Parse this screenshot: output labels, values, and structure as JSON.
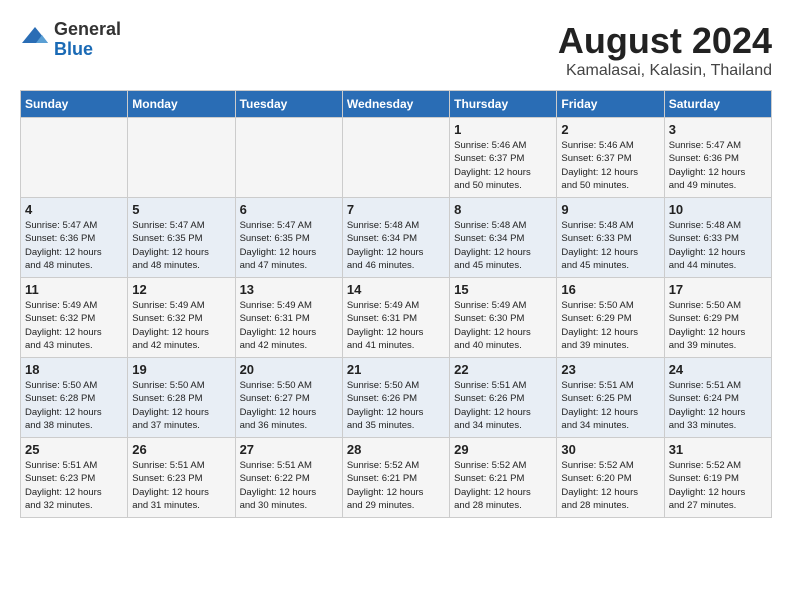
{
  "header": {
    "logo_general": "General",
    "logo_blue": "Blue",
    "month_year": "August 2024",
    "location": "Kamalasai, Kalasin, Thailand"
  },
  "days_of_week": [
    "Sunday",
    "Monday",
    "Tuesday",
    "Wednesday",
    "Thursday",
    "Friday",
    "Saturday"
  ],
  "weeks": [
    [
      {
        "day": "",
        "info": ""
      },
      {
        "day": "",
        "info": ""
      },
      {
        "day": "",
        "info": ""
      },
      {
        "day": "",
        "info": ""
      },
      {
        "day": "1",
        "info": "Sunrise: 5:46 AM\nSunset: 6:37 PM\nDaylight: 12 hours\nand 50 minutes."
      },
      {
        "day": "2",
        "info": "Sunrise: 5:46 AM\nSunset: 6:37 PM\nDaylight: 12 hours\nand 50 minutes."
      },
      {
        "day": "3",
        "info": "Sunrise: 5:47 AM\nSunset: 6:36 PM\nDaylight: 12 hours\nand 49 minutes."
      }
    ],
    [
      {
        "day": "4",
        "info": "Sunrise: 5:47 AM\nSunset: 6:36 PM\nDaylight: 12 hours\nand 48 minutes."
      },
      {
        "day": "5",
        "info": "Sunrise: 5:47 AM\nSunset: 6:35 PM\nDaylight: 12 hours\nand 48 minutes."
      },
      {
        "day": "6",
        "info": "Sunrise: 5:47 AM\nSunset: 6:35 PM\nDaylight: 12 hours\nand 47 minutes."
      },
      {
        "day": "7",
        "info": "Sunrise: 5:48 AM\nSunset: 6:34 PM\nDaylight: 12 hours\nand 46 minutes."
      },
      {
        "day": "8",
        "info": "Sunrise: 5:48 AM\nSunset: 6:34 PM\nDaylight: 12 hours\nand 45 minutes."
      },
      {
        "day": "9",
        "info": "Sunrise: 5:48 AM\nSunset: 6:33 PM\nDaylight: 12 hours\nand 45 minutes."
      },
      {
        "day": "10",
        "info": "Sunrise: 5:48 AM\nSunset: 6:33 PM\nDaylight: 12 hours\nand 44 minutes."
      }
    ],
    [
      {
        "day": "11",
        "info": "Sunrise: 5:49 AM\nSunset: 6:32 PM\nDaylight: 12 hours\nand 43 minutes."
      },
      {
        "day": "12",
        "info": "Sunrise: 5:49 AM\nSunset: 6:32 PM\nDaylight: 12 hours\nand 42 minutes."
      },
      {
        "day": "13",
        "info": "Sunrise: 5:49 AM\nSunset: 6:31 PM\nDaylight: 12 hours\nand 42 minutes."
      },
      {
        "day": "14",
        "info": "Sunrise: 5:49 AM\nSunset: 6:31 PM\nDaylight: 12 hours\nand 41 minutes."
      },
      {
        "day": "15",
        "info": "Sunrise: 5:49 AM\nSunset: 6:30 PM\nDaylight: 12 hours\nand 40 minutes."
      },
      {
        "day": "16",
        "info": "Sunrise: 5:50 AM\nSunset: 6:29 PM\nDaylight: 12 hours\nand 39 minutes."
      },
      {
        "day": "17",
        "info": "Sunrise: 5:50 AM\nSunset: 6:29 PM\nDaylight: 12 hours\nand 39 minutes."
      }
    ],
    [
      {
        "day": "18",
        "info": "Sunrise: 5:50 AM\nSunset: 6:28 PM\nDaylight: 12 hours\nand 38 minutes."
      },
      {
        "day": "19",
        "info": "Sunrise: 5:50 AM\nSunset: 6:28 PM\nDaylight: 12 hours\nand 37 minutes."
      },
      {
        "day": "20",
        "info": "Sunrise: 5:50 AM\nSunset: 6:27 PM\nDaylight: 12 hours\nand 36 minutes."
      },
      {
        "day": "21",
        "info": "Sunrise: 5:50 AM\nSunset: 6:26 PM\nDaylight: 12 hours\nand 35 minutes."
      },
      {
        "day": "22",
        "info": "Sunrise: 5:51 AM\nSunset: 6:26 PM\nDaylight: 12 hours\nand 34 minutes."
      },
      {
        "day": "23",
        "info": "Sunrise: 5:51 AM\nSunset: 6:25 PM\nDaylight: 12 hours\nand 34 minutes."
      },
      {
        "day": "24",
        "info": "Sunrise: 5:51 AM\nSunset: 6:24 PM\nDaylight: 12 hours\nand 33 minutes."
      }
    ],
    [
      {
        "day": "25",
        "info": "Sunrise: 5:51 AM\nSunset: 6:23 PM\nDaylight: 12 hours\nand 32 minutes."
      },
      {
        "day": "26",
        "info": "Sunrise: 5:51 AM\nSunset: 6:23 PM\nDaylight: 12 hours\nand 31 minutes."
      },
      {
        "day": "27",
        "info": "Sunrise: 5:51 AM\nSunset: 6:22 PM\nDaylight: 12 hours\nand 30 minutes."
      },
      {
        "day": "28",
        "info": "Sunrise: 5:52 AM\nSunset: 6:21 PM\nDaylight: 12 hours\nand 29 minutes."
      },
      {
        "day": "29",
        "info": "Sunrise: 5:52 AM\nSunset: 6:21 PM\nDaylight: 12 hours\nand 28 minutes."
      },
      {
        "day": "30",
        "info": "Sunrise: 5:52 AM\nSunset: 6:20 PM\nDaylight: 12 hours\nand 28 minutes."
      },
      {
        "day": "31",
        "info": "Sunrise: 5:52 AM\nSunset: 6:19 PM\nDaylight: 12 hours\nand 27 minutes."
      }
    ]
  ]
}
